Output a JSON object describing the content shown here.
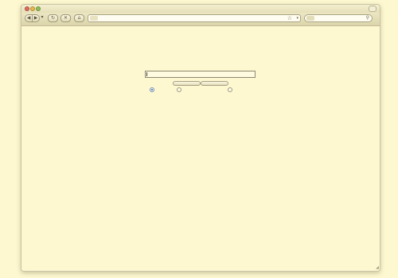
{
  "browser": {
    "title": "",
    "toolbar": {
      "back_icon": "back-arrow-icon",
      "forward_icon": "forward-arrow-icon",
      "reload_icon": "reload-icon",
      "stop_icon": "stop-icon",
      "home_icon": "home-icon",
      "back_glyph": "◀",
      "forward_glyph": "▶",
      "dropdown_glyph": "▾",
      "reload_glyph": "↻",
      "stop_glyph": "✕",
      "home_glyph": "⌂"
    },
    "address_bar": {
      "value": "",
      "placeholder": "",
      "star_glyph": "☆",
      "dropdown_glyph": "▾"
    },
    "search_bar": {
      "value": "",
      "placeholder": "",
      "magnifier_glyph": "⚲"
    },
    "colors": {
      "page_background": "#fdf8d0",
      "chrome_background": "#e6e0b8",
      "close_light": "#e06b5c",
      "minimize_light": "#e9b94b",
      "maximize_light": "#8fbf5a",
      "radio_selected": "#3d63a8"
    }
  },
  "page": {
    "query_input": {
      "value": "",
      "placeholder": ""
    },
    "buttons": [
      {
        "label": ""
      },
      {
        "label": ""
      }
    ],
    "radio_options": [
      {
        "label": "",
        "checked": true
      },
      {
        "label": "",
        "checked": false
      },
      {
        "label": "",
        "checked": false
      }
    ]
  }
}
